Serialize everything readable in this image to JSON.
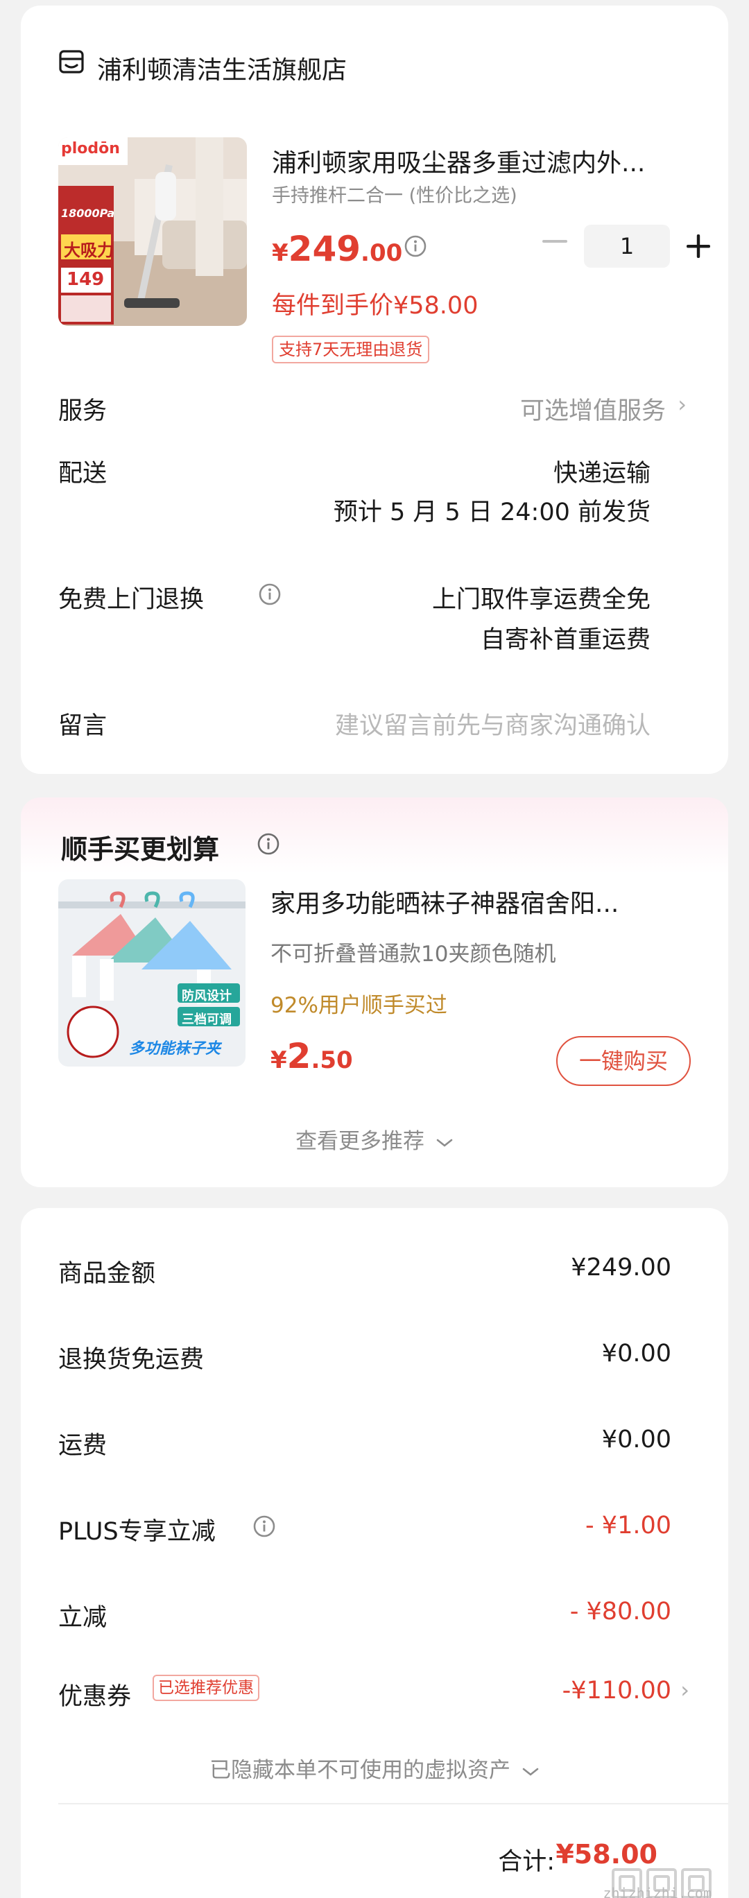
{
  "store": {
    "name": "浦利顿清洁生活旗舰店",
    "icon": "store-icon"
  },
  "product": {
    "title": "浦利顿家用吸尘器多重过滤内外...",
    "spec": "手持推杆二合一 (性价比之选)",
    "price": {
      "currency": "¥",
      "integer": "249",
      "decimal": ".00"
    },
    "quantity": "1",
    "unit_price_text": "每件到手价¥58.00",
    "return_badge": "支持7天无理由退货",
    "thumb_texts": {
      "brand": "plodōn",
      "suction": "18000Pa",
      "strong": "大吸力",
      "price": "149"
    }
  },
  "rows": {
    "service": {
      "label": "服务",
      "value": "可选增值服务"
    },
    "delivery": {
      "label": "配送",
      "value": "快递运输",
      "sub": "预计 5 月 5 日 24:00 前发货"
    },
    "free_return": {
      "label": "免费上门退换",
      "value": "上门取件享运费全免",
      "sub": "自寄补首重运费"
    },
    "message": {
      "label": "留言",
      "placeholder": "建议留言前先与商家沟通确认"
    }
  },
  "recommend": {
    "title": "顺手买更划算",
    "product": {
      "title": "家用多功能晒袜子神器宿舍阳...",
      "spec": "不可折叠普通款10夹颜色随机",
      "promo": "92%用户顺手买过",
      "price": {
        "currency": "¥",
        "integer": "2",
        "decimal": ".50"
      },
      "buy_label": "一键购买",
      "thumb_texts": {
        "t1": "防风设计",
        "t2": "三档可调",
        "t3": "多功能袜子夹"
      }
    },
    "more_label": "查看更多推荐"
  },
  "summary": {
    "items_amount": {
      "label": "商品金额",
      "value": "¥249.00"
    },
    "return_shipping": {
      "label": "退换货免运费",
      "value": "¥0.00"
    },
    "shipping": {
      "label": "运费",
      "value": "¥0.00"
    },
    "plus_discount": {
      "label": "PLUS专享立减",
      "value": "- ¥1.00"
    },
    "discount": {
      "label": "立减",
      "value": "- ¥80.00"
    },
    "coupon": {
      "label": "优惠券",
      "badge": "已选推荐优惠",
      "value": "-¥110.00"
    },
    "hidden_assets": "已隐藏本单不可使用的虚拟资产",
    "total_label": "合计:",
    "total_value": "¥58.00",
    "watermark_domain": "zhizhizhi.com"
  },
  "colors": {
    "accent": "#e03e30",
    "promo": "#c08a2a",
    "muted": "#999999"
  }
}
